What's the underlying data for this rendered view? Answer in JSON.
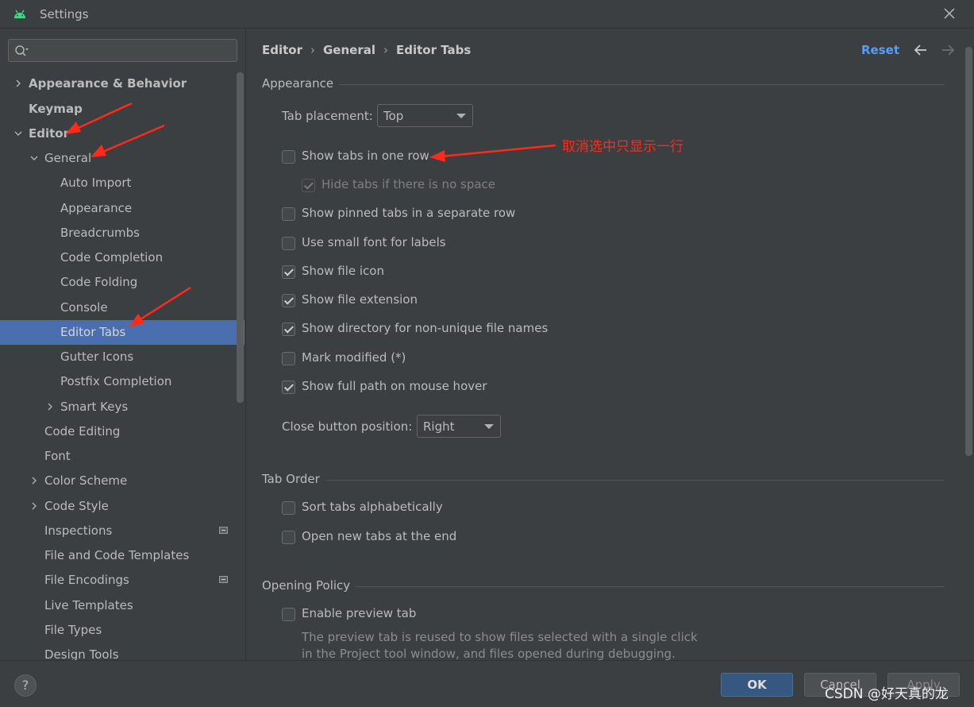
{
  "window": {
    "title": "Settings"
  },
  "search": {
    "placeholder": ""
  },
  "sidebar": {
    "items": [
      {
        "label": "Appearance & Behavior"
      },
      {
        "label": "Keymap"
      },
      {
        "label": "Editor"
      },
      {
        "label": "General"
      },
      {
        "label": "Auto Import"
      },
      {
        "label": "Appearance"
      },
      {
        "label": "Breadcrumbs"
      },
      {
        "label": "Code Completion"
      },
      {
        "label": "Code Folding"
      },
      {
        "label": "Console"
      },
      {
        "label": "Editor Tabs"
      },
      {
        "label": "Gutter Icons"
      },
      {
        "label": "Postfix Completion"
      },
      {
        "label": "Smart Keys"
      },
      {
        "label": "Code Editing"
      },
      {
        "label": "Font"
      },
      {
        "label": "Color Scheme"
      },
      {
        "label": "Code Style"
      },
      {
        "label": "Inspections"
      },
      {
        "label": "File and Code Templates"
      },
      {
        "label": "File Encodings"
      },
      {
        "label": "Live Templates"
      },
      {
        "label": "File Types"
      },
      {
        "label": "Design Tools"
      }
    ]
  },
  "breadcrumb": {
    "items": [
      "Editor",
      "General",
      "Editor Tabs"
    ]
  },
  "toolbar": {
    "reset_label": "Reset"
  },
  "sections": {
    "appearance": {
      "title": "Appearance",
      "tab_placement_label": "Tab placement:",
      "tab_placement_value": "Top",
      "options": [
        {
          "label": "Show tabs in one row",
          "checked": false
        },
        {
          "label": "Hide tabs if there is no space",
          "checked": true,
          "disabled": true
        },
        {
          "label": "Show pinned tabs in a separate row",
          "checked": false
        },
        {
          "label": "Use small font for labels",
          "checked": false
        },
        {
          "label": "Show file icon",
          "checked": true
        },
        {
          "label": "Show file extension",
          "checked": true
        },
        {
          "label": "Show directory for non-unique file names",
          "checked": true
        },
        {
          "label": "Mark modified (*)",
          "checked": false
        },
        {
          "label": "Show full path on mouse hover",
          "checked": true
        }
      ],
      "close_button_label": "Close button position:",
      "close_button_value": "Right"
    },
    "tab_order": {
      "title": "Tab Order",
      "options": [
        {
          "label": "Sort tabs alphabetically",
          "checked": false
        },
        {
          "label": "Open new tabs at the end",
          "checked": false
        }
      ]
    },
    "opening_policy": {
      "title": "Opening Policy",
      "options": [
        {
          "label": "Enable preview tab",
          "checked": false
        }
      ],
      "description_line1": "The preview tab is reused to show files selected with a single click",
      "description_line2": "in the Project tool window, and files opened during debugging."
    }
  },
  "annotation": {
    "text": "取消选中只显示一行",
    "color": "#ff2a1a"
  },
  "footer": {
    "help_label": "?",
    "ok_label": "OK",
    "cancel_label": "Cancel",
    "apply_label": "Apply",
    "watermark": "CSDN @好天真的龙"
  },
  "colors": {
    "selection": "#4b6eaf",
    "link": "#589df6",
    "ok_button": "#365880"
  }
}
